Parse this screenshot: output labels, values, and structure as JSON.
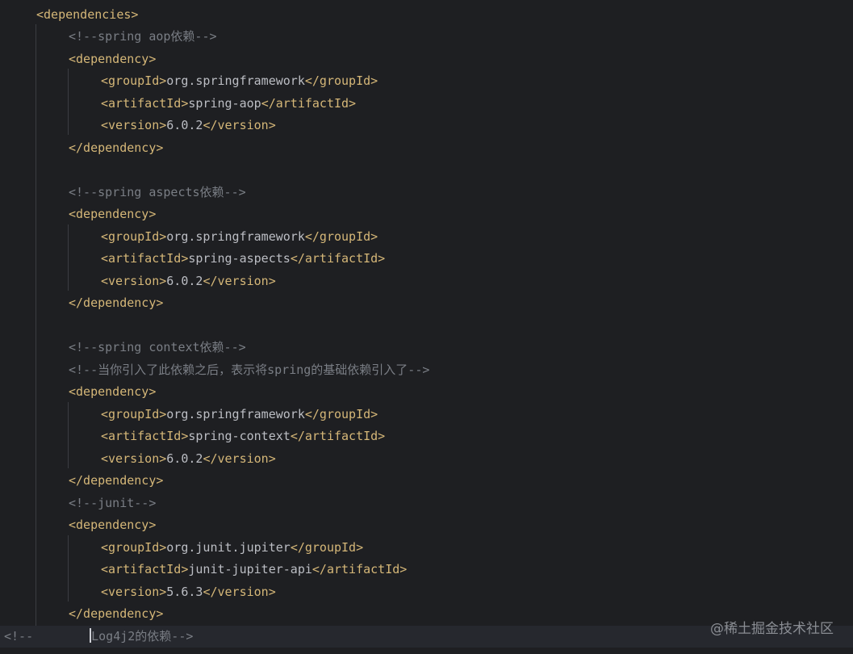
{
  "editor": {
    "language": "xml",
    "lines": [
      {
        "indent": 1,
        "kind": "tag",
        "text": "<dependencies>"
      },
      {
        "indent": 2,
        "kind": "comment",
        "text": "<!--spring aop依赖-->"
      },
      {
        "indent": 2,
        "kind": "tag",
        "text": "<dependency>"
      },
      {
        "indent": 3,
        "kind": "element",
        "open": "<groupId>",
        "value": "org.springframework",
        "close": "</groupId>"
      },
      {
        "indent": 3,
        "kind": "element",
        "open": "<artifactId>",
        "value": "spring-aop",
        "close": "</artifactId>"
      },
      {
        "indent": 3,
        "kind": "element",
        "open": "<version>",
        "value": "6.0.2",
        "close": "</version>"
      },
      {
        "indent": 2,
        "kind": "tag",
        "text": "</dependency>"
      },
      {
        "indent": 0,
        "kind": "blank",
        "text": ""
      },
      {
        "indent": 2,
        "kind": "comment",
        "text": "<!--spring aspects依赖-->"
      },
      {
        "indent": 2,
        "kind": "tag",
        "text": "<dependency>"
      },
      {
        "indent": 3,
        "kind": "element",
        "open": "<groupId>",
        "value": "org.springframework",
        "close": "</groupId>"
      },
      {
        "indent": 3,
        "kind": "element",
        "open": "<artifactId>",
        "value": "spring-aspects",
        "close": "</artifactId>"
      },
      {
        "indent": 3,
        "kind": "element",
        "open": "<version>",
        "value": "6.0.2",
        "close": "</version>"
      },
      {
        "indent": 2,
        "kind": "tag",
        "text": "</dependency>"
      },
      {
        "indent": 0,
        "kind": "blank",
        "text": ""
      },
      {
        "indent": 2,
        "kind": "comment",
        "text": "<!--spring context依赖-->"
      },
      {
        "indent": 2,
        "kind": "comment",
        "text": "<!--当你引入了此依赖之后，表示将spring的基础依赖引入了-->"
      },
      {
        "indent": 2,
        "kind": "tag",
        "text": "<dependency>"
      },
      {
        "indent": 3,
        "kind": "element",
        "open": "<groupId>",
        "value": "org.springframework",
        "close": "</groupId>"
      },
      {
        "indent": 3,
        "kind": "element",
        "open": "<artifactId>",
        "value": "spring-context",
        "close": "</artifactId>"
      },
      {
        "indent": 3,
        "kind": "element",
        "open": "<version>",
        "value": "6.0.2",
        "close": "</version>"
      },
      {
        "indent": 2,
        "kind": "tag",
        "text": "</dependency>"
      },
      {
        "indent": 2,
        "kind": "comment",
        "text": "<!--junit-->"
      },
      {
        "indent": 2,
        "kind": "tag",
        "text": "<dependency>"
      },
      {
        "indent": 3,
        "kind": "element",
        "open": "<groupId>",
        "value": "org.junit.jupiter",
        "close": "</groupId>"
      },
      {
        "indent": 3,
        "kind": "element",
        "open": "<artifactId>",
        "value": "junit-jupiter-api",
        "close": "</artifactId>"
      },
      {
        "indent": 3,
        "kind": "element",
        "open": "<version>",
        "value": "5.6.3",
        "close": "</version>"
      },
      {
        "indent": 2,
        "kind": "tag",
        "text": "</dependency>"
      },
      {
        "indent": 0,
        "kind": "current",
        "prefix": "<!--",
        "value": "Log4j2的依赖-->"
      }
    ]
  },
  "watermark": "@稀土掘金技术社区",
  "colors": {
    "background": "#1e1f22",
    "current_line": "#26282e",
    "tag": "#d5b778",
    "text": "#bcbec4",
    "comment": "#7a7e85"
  }
}
